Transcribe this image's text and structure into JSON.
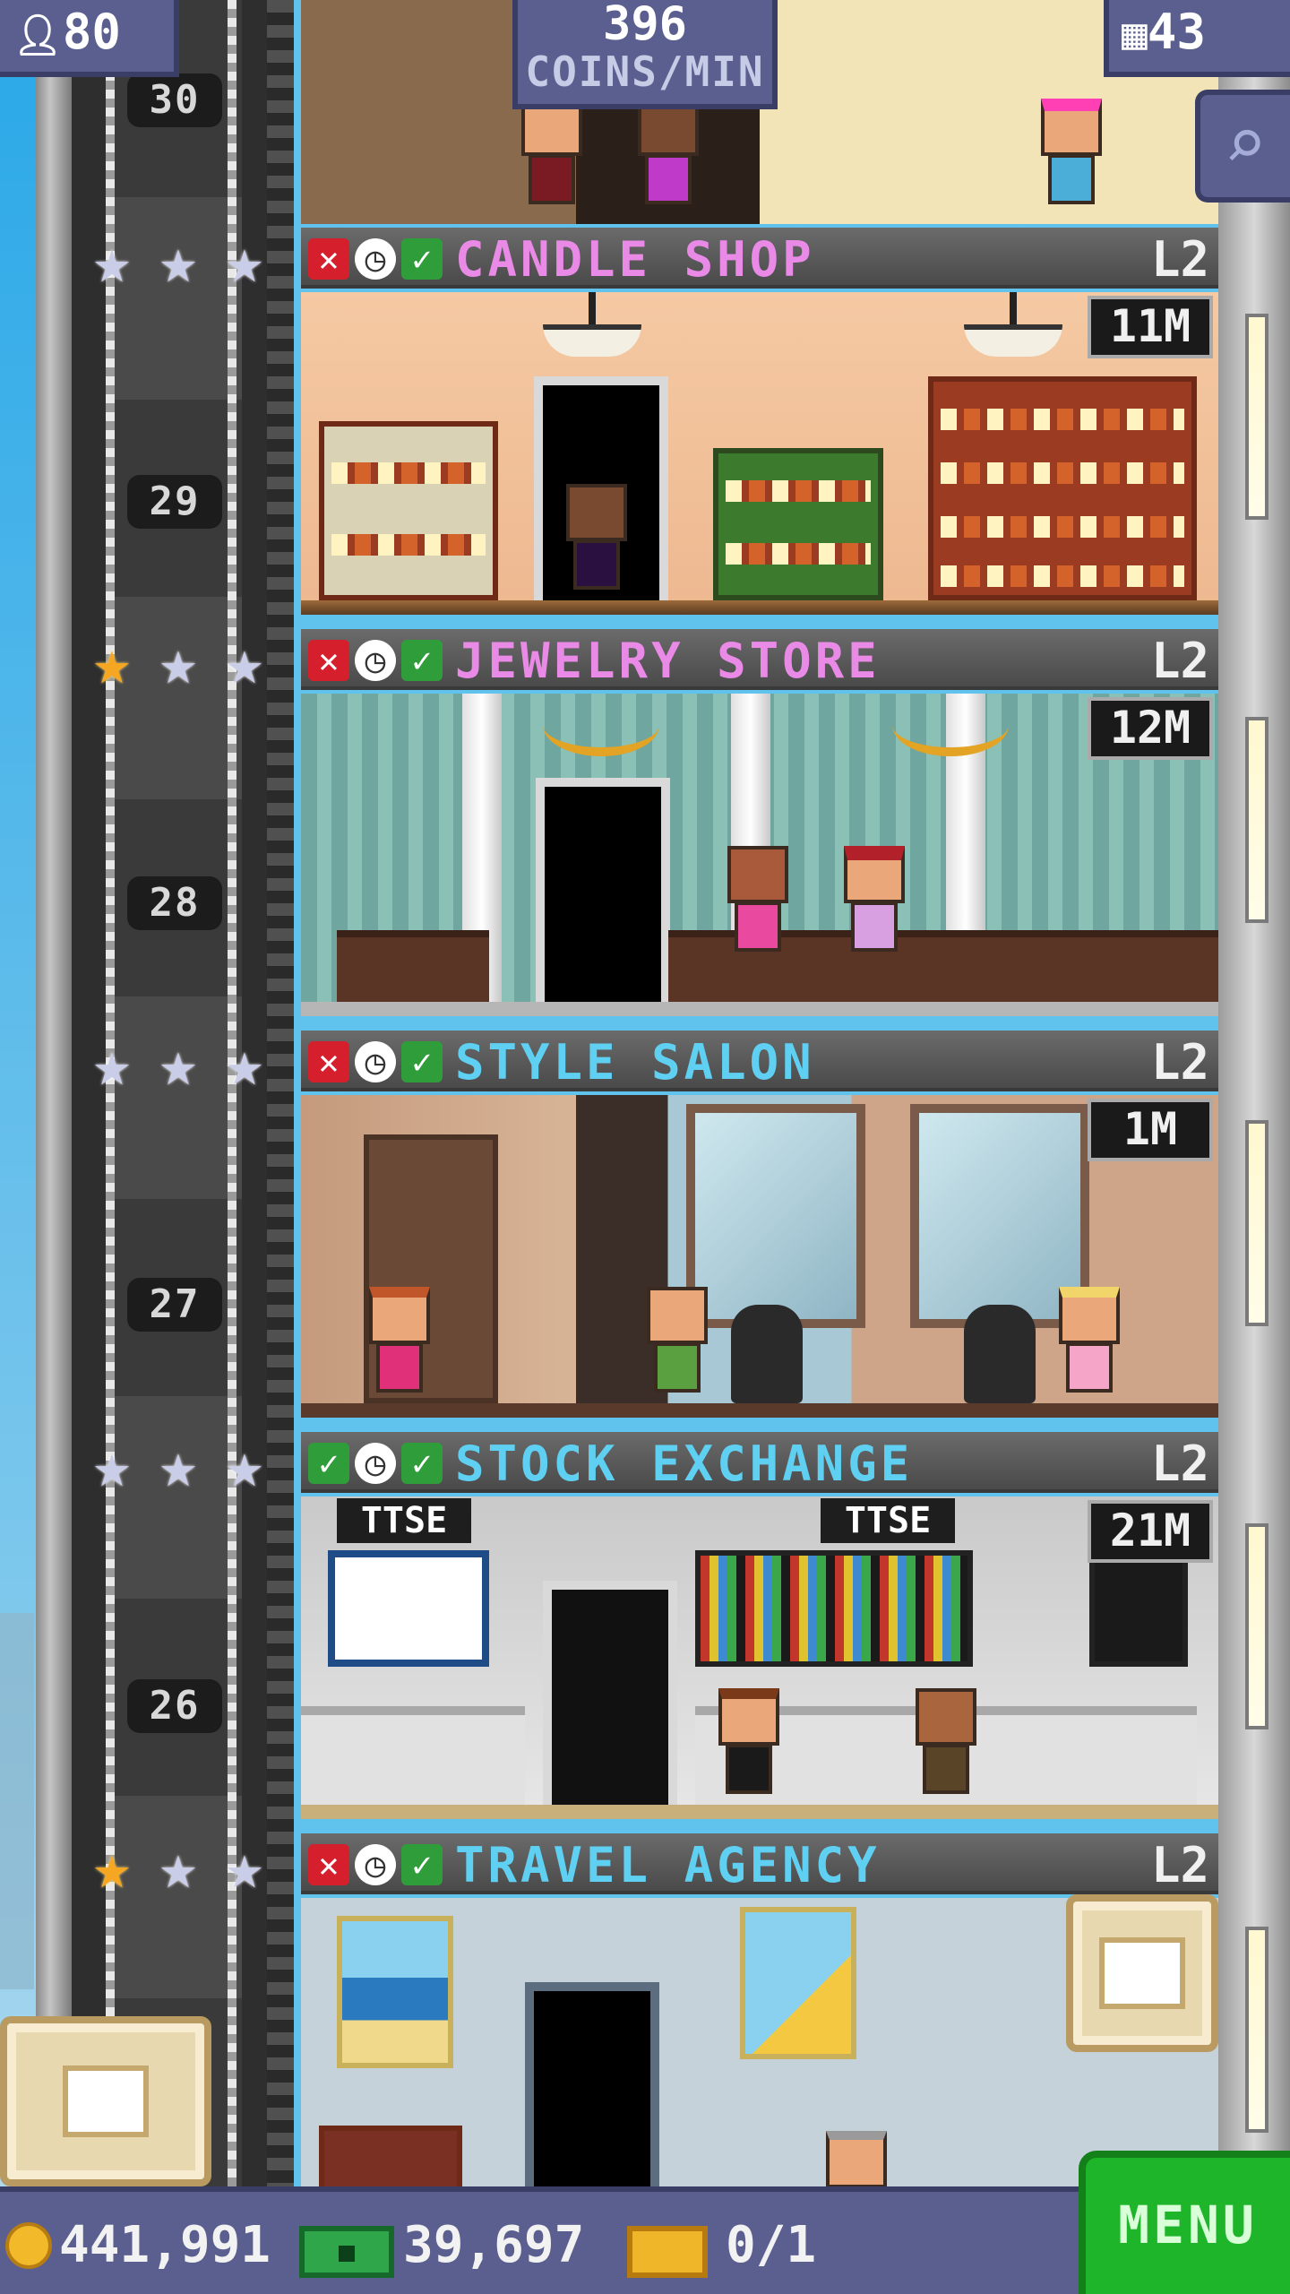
{
  "hud": {
    "population": "80",
    "coins_rate_value": "396",
    "coins_rate_unit": "COINS/MIN",
    "floors_count": "43"
  },
  "floors": [
    {
      "number": "30"
    },
    {
      "number": "29",
      "name": "CANDLE SHOP",
      "level": "L2",
      "income": "11M",
      "name_color": "#e98ae6",
      "stars": 0,
      "status": [
        "x",
        "clock",
        "check"
      ]
    },
    {
      "number": "28",
      "name": "JEWELRY STORE",
      "level": "L2",
      "income": "12M",
      "name_color": "#e98ae6",
      "stars": 1,
      "status": [
        "x",
        "clock",
        "check"
      ]
    },
    {
      "number": "27",
      "name": "STYLE SALON",
      "level": "L2",
      "income": "1M",
      "name_color": "#5fd0f2",
      "stars": 0,
      "status": [
        "x",
        "clock",
        "check"
      ]
    },
    {
      "number": "26",
      "name": "STOCK EXCHANGE",
      "level": "L2",
      "income": "21M",
      "name_color": "#5fd0f2",
      "stars": 0,
      "status": [
        "check",
        "clock",
        "check"
      ]
    },
    {
      "name": "TRAVEL AGENCY",
      "level": "L2",
      "name_color": "#5fd0f2",
      "stars": 1,
      "status": [
        "x",
        "clock",
        "check"
      ]
    }
  ],
  "stock_signs": [
    "TTSE",
    "TTSE"
  ],
  "bottom_bar": {
    "coins": "441,991",
    "bux": "39,697",
    "tickets": "0/1",
    "menu_label": "MENU"
  },
  "icons": {
    "population": "person-icon",
    "floors": "building-icon",
    "search": "magnifier-icon",
    "coins": "coin-icon",
    "bux": "bux-icon",
    "tickets": "ticket-icon"
  },
  "colors": {
    "hud_bg": "#5a5f8f",
    "menu_green": "#1fb52a",
    "star_gold": "#f5a623",
    "star_silver": "#c9cde8"
  }
}
